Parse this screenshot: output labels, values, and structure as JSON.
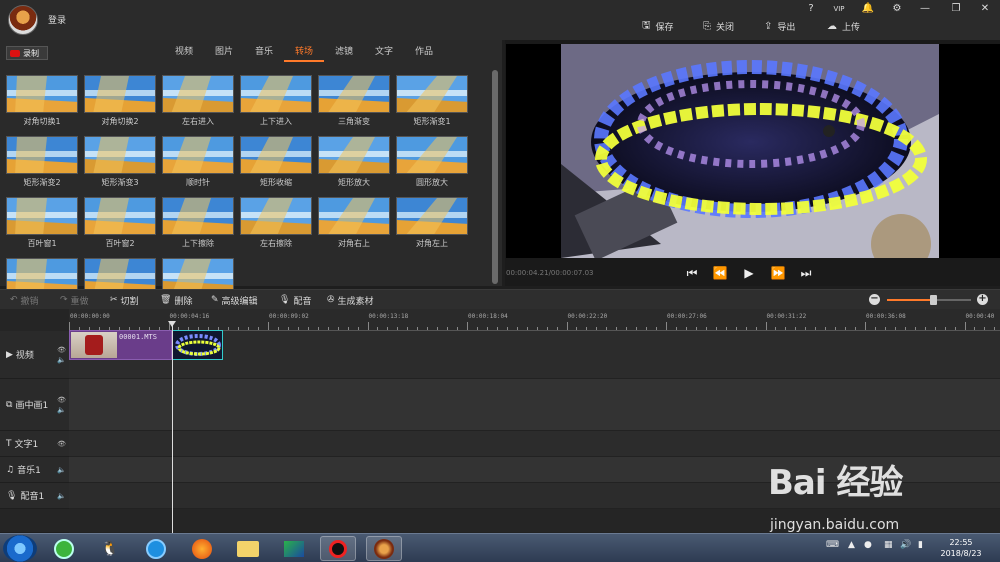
{
  "titlebar": {
    "login": "登录",
    "window_controls": [
      "?",
      "VIP",
      "🔔",
      "⚙",
      "—",
      "❐",
      "✕"
    ],
    "buttons": [
      {
        "label": "保存",
        "icon": "save-icon"
      },
      {
        "label": "关闭",
        "icon": "close-icon"
      },
      {
        "label": "导出",
        "icon": "export-icon"
      },
      {
        "label": "上传",
        "icon": "upload-icon"
      }
    ]
  },
  "library": {
    "record_label": "录制",
    "tabs": [
      {
        "label": "视频",
        "active": false
      },
      {
        "label": "图片",
        "active": false
      },
      {
        "label": "音乐",
        "active": false
      },
      {
        "label": "转场",
        "active": true
      },
      {
        "label": "滤镜",
        "active": false
      },
      {
        "label": "文字",
        "active": false
      },
      {
        "label": "作品",
        "active": false
      }
    ],
    "transitions": [
      "对角切换1",
      "对角切换2",
      "左右进入",
      "上下进入",
      "三角渐变",
      "矩形渐变1",
      "矩形渐变2",
      "矩形渐变3",
      "顺时针",
      "矩形收缩",
      "矩形放大",
      "圆形放大",
      "百叶窗1",
      "百叶窗2",
      "上下擦除",
      "左右擦除",
      "对角右上",
      "对角左上",
      "",
      "",
      ""
    ]
  },
  "preview": {
    "time": "00:00:04.21/00:00:07.03",
    "controls": [
      "⏮",
      "⏪",
      "▶",
      "⏩",
      "⏭"
    ]
  },
  "toolbar": {
    "undo": "撤销",
    "redo": "重做",
    "cut": "切割",
    "delete": "删除",
    "advanced_edit": "高级编辑",
    "dub": "配音",
    "generate": "生成素材",
    "zoom_level": 0.55
  },
  "timeline": {
    "ticks": [
      "00:00:00:00",
      "00:00:04:16",
      "00:00:09:02",
      "00:00:13:18",
      "00:00:18:04",
      "00:00:22:20",
      "00:00:27:06",
      "00:00:31:22",
      "00:00:36:08",
      "00:00:40"
    ],
    "tracks": [
      {
        "label": "视频",
        "icon": "play-square-icon"
      },
      {
        "label": "画中画1",
        "icon": "pip-icon"
      },
      {
        "label": "文字1",
        "icon": "text-icon"
      },
      {
        "label": "音乐1",
        "icon": "music-icon"
      },
      {
        "label": "配音1",
        "icon": "mic-icon"
      }
    ],
    "clip1_name": "00001.MTS"
  },
  "taskbar": {
    "time": "22:55",
    "date": "2018/8/23"
  },
  "watermark": {
    "logo": "Bai 经验",
    "url": "jingyan.baidu.com"
  }
}
